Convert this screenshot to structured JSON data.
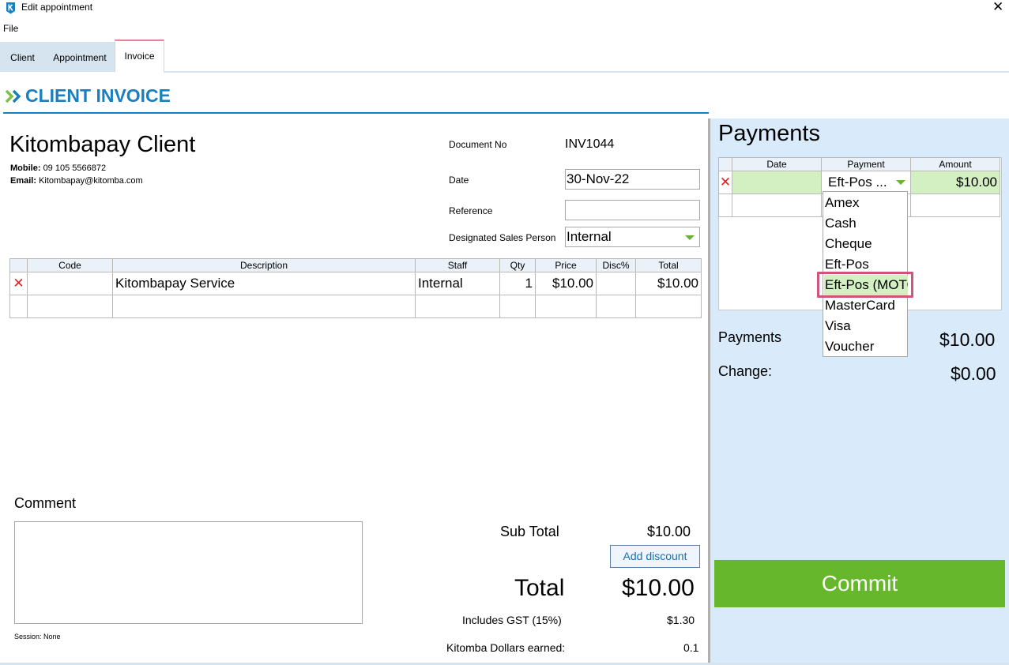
{
  "window": {
    "title": "Edit appointment"
  },
  "menu": {
    "file": "File"
  },
  "tabs": [
    {
      "label": "Client"
    },
    {
      "label": "Appointment"
    },
    {
      "label": "Invoice"
    }
  ],
  "header": {
    "title": "CLIENT INVOICE"
  },
  "client": {
    "name": "Kitombapay Client",
    "mobile_label": "Mobile:",
    "mobile": "09 105 5566872",
    "email_label": "Email:",
    "email": "Kitombapay@kitomba.com"
  },
  "document": {
    "doc_no_label": "Document No",
    "doc_no": "INV1044",
    "date_label": "Date",
    "date": "30-Nov-22",
    "reference_label": "Reference",
    "reference": "",
    "sales_person_label": "Designated Sales Person",
    "sales_person": "Internal"
  },
  "items": {
    "headers": [
      "",
      "Code",
      "Description",
      "Staff",
      "Qty",
      "Price",
      "Disc%",
      "Total"
    ],
    "rows": [
      {
        "code": "",
        "description": "Kitombapay Service",
        "staff": "Internal",
        "qty": "1",
        "price": "$10.00",
        "disc": "",
        "total": "$10.00"
      }
    ]
  },
  "comment": {
    "label": "Comment",
    "value": ""
  },
  "session": "Session: None",
  "totals": {
    "sub_total_label": "Sub Total",
    "sub_total": "$10.00",
    "discount_button": "Add discount",
    "total_label": "Total",
    "total": "$10.00",
    "gst_label": "Includes GST (15%)",
    "gst": "$1.30",
    "kitomba_dollars_label": "Kitomba Dollars earned:",
    "kitomba_dollars": "0.1"
  },
  "payments": {
    "title": "Payments",
    "headers": [
      "",
      "Date",
      "Payment",
      "Amount"
    ],
    "rows": [
      {
        "date": "",
        "payment": "Eft-Pos ...",
        "amount": "$10.00"
      }
    ],
    "dropdown_options": [
      "Amex",
      "Cash",
      "Cheque",
      "Eft-Pos",
      "Eft-Pos (MOTO)",
      "MasterCard",
      "Visa",
      "Voucher"
    ],
    "dropdown_selected_index": 4,
    "summary": {
      "payments_label": "Payments",
      "payments_value": "$10.00",
      "change_label": "Change:",
      "change_value": "$0.00"
    },
    "commit_button": "Commit"
  },
  "colors": {
    "brand_blue": "#1a7fbf",
    "commit_green": "#67b72d",
    "panel_blue": "#d9ebfb",
    "highlight_pink": "#d1547a",
    "selected_green": "#d3f0c2",
    "delete_red": "#e02020"
  }
}
